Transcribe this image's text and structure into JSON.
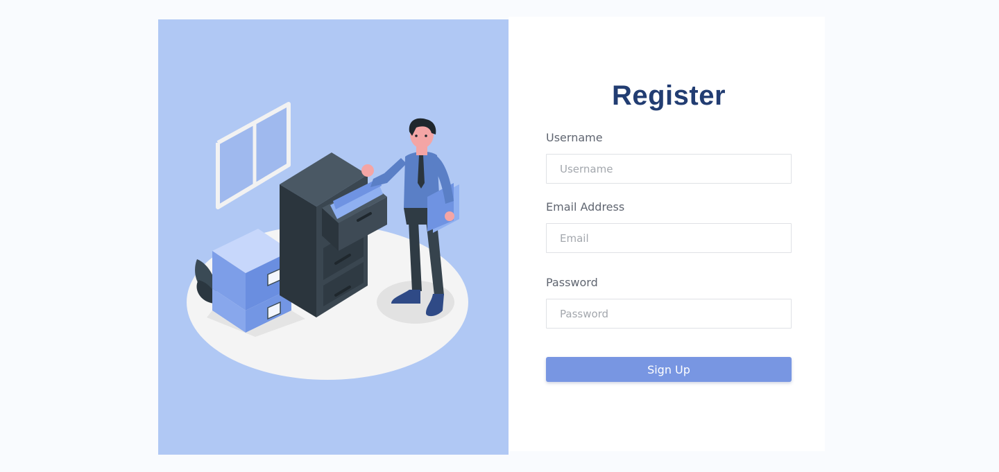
{
  "form": {
    "title": "Register",
    "username": {
      "label": "Username",
      "placeholder": "Username",
      "value": ""
    },
    "email": {
      "label": "Email Address",
      "placeholder": "Email",
      "value": ""
    },
    "password": {
      "label": "Password",
      "placeholder": "Password",
      "value": ""
    },
    "submit_label": "Sign Up"
  },
  "colors": {
    "page_background": "#f9fbfe",
    "illustration_background": "#b0c8f4",
    "title": "#223d72",
    "button": "#7896e2",
    "cabinet": "#36434d",
    "boxes": "#6f93e2"
  },
  "illustration": {
    "icon": "office-filing-illustration"
  }
}
